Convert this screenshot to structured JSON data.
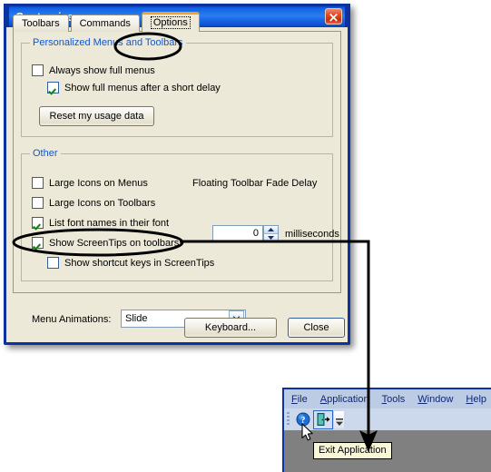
{
  "dialog": {
    "title": "Customize",
    "close_icon": "close-icon",
    "tabs": [
      {
        "label": "Toolbars",
        "active": false
      },
      {
        "label": "Commands",
        "active": false
      },
      {
        "label": "Options",
        "active": true
      }
    ],
    "groups": {
      "personalized": {
        "label": "Personalized Menus and Toolbars",
        "checkboxes": [
          {
            "label": "Always show full menus",
            "checked": false
          },
          {
            "label": "Show full menus after a short delay",
            "checked": true
          }
        ],
        "reset_button": "Reset my usage data"
      },
      "other": {
        "label": "Other",
        "checkboxes": [
          {
            "label": "Large Icons on Menus",
            "checked": false
          },
          {
            "label": "Large Icons on Toolbars",
            "checked": false
          },
          {
            "label": "List font names in their font",
            "checked": true
          },
          {
            "label": "Show ScreenTips on toolbars",
            "checked": true
          },
          {
            "label": "Show shortcut keys in ScreenTips",
            "checked": false
          }
        ],
        "fade_delay_label": "Floating Toolbar Fade Delay",
        "fade_delay_value": "0",
        "fade_delay_units": "milliseconds",
        "spinner_up_icon": "spinner-up-icon",
        "spinner_down_icon": "spinner-down-icon"
      }
    },
    "menu_animations_label": "Menu Animations:",
    "menu_animations_value": "Slide",
    "menu_animations_options": [
      "Slide"
    ],
    "menu_animations_arrow_icon": "chevron-down-icon",
    "footer_buttons": [
      {
        "label": "Keyboard...",
        "default": false
      },
      {
        "label": "Close",
        "default": true
      }
    ]
  },
  "app_window": {
    "menus": [
      {
        "label": "File",
        "accel": "F"
      },
      {
        "label": "Application",
        "accel": "A"
      },
      {
        "label": "Tools",
        "accel": "T"
      },
      {
        "label": "Window",
        "accel": "W"
      },
      {
        "label": "Help",
        "accel": "H"
      }
    ],
    "toolbar": {
      "grip_icon": "toolbar-grip-icon",
      "help_icon": "help-about-icon",
      "exit_icon": "exit-application-icon",
      "overflow_icon": "toolbar-overflow-icon"
    },
    "tooltip_text": "Exit Application",
    "cursor_icon": "mouse-pointer-icon"
  },
  "annotation": {
    "ellipse_tab_target": "Options",
    "ellipse_option_target": "Show ScreenTips on toolbars",
    "arrow_target": "Exit Application",
    "line_color": "#000000"
  },
  "colors": {
    "titlebar_blue": "#1063e6",
    "frame_blue": "#0a32a0",
    "dialog_face": "#ece9d8",
    "group_label_blue": "#1457c8",
    "check_green": "#128017",
    "tab_active_orange": "#f0a32a",
    "tooltip_yellow": "#f8f8d8",
    "menubar_blue": "#bccce4",
    "client_gray": "#808080"
  }
}
